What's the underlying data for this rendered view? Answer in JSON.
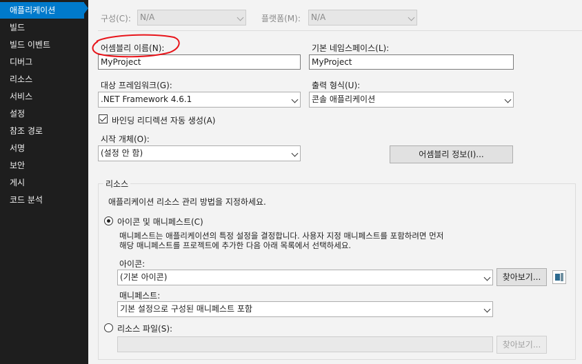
{
  "sidebar": {
    "items": [
      {
        "label": "애플리케이션",
        "selected": true
      },
      {
        "label": "빌드"
      },
      {
        "label": "빌드 이벤트"
      },
      {
        "label": "디버그"
      },
      {
        "label": "리소스"
      },
      {
        "label": "서비스"
      },
      {
        "label": "설정"
      },
      {
        "label": "참조 경로"
      },
      {
        "label": "서명"
      },
      {
        "label": "보안"
      },
      {
        "label": "게시"
      },
      {
        "label": "코드 분석"
      }
    ],
    "selected_color": "#007acc"
  },
  "top": {
    "config_label": "구성(C):",
    "config_value": "N/A",
    "platform_label": "플랫폼(M):",
    "platform_value": "N/A"
  },
  "assembly": {
    "label": "어셈블리 이름(N):",
    "value": "MyProject",
    "highlight_color": "#e8141a"
  },
  "namespace": {
    "label": "기본 네임스페이스(L):",
    "value": "MyProject"
  },
  "target_framework": {
    "label": "대상 프레임워크(G):",
    "value": ".NET Framework 4.6.1"
  },
  "output_type": {
    "label": "출력 형식(U):",
    "value": "콘솔 애플리케이션"
  },
  "binding_redirect": {
    "label": "바인딩 리디렉션 자동 생성(A)",
    "checked": true
  },
  "startup_object": {
    "label": "시작 개체(O):",
    "value": "(설정 안 함)"
  },
  "assembly_info_button": "어셈블리 정보(I)...",
  "resources": {
    "title": "리소스",
    "description": "애플리케이션 리소스 관리 방법을 지정하세요.",
    "icon_manifest_option": {
      "label": "아이콘 및 매니페스트(C)",
      "selected": true,
      "help_line1": "매니페스트는 애플리케이션의 특정 설정을 결정합니다. 사용자 지정 매니페스트를 포함하려면 먼저",
      "help_line2": "해당 매니페스트를 프로젝트에 추가한 다음 아래 목록에서 선택하세요."
    },
    "icon": {
      "label": "아이콘:",
      "value": "(기본 아이콘)",
      "browse_button": "찾아보기..."
    },
    "manifest": {
      "label": "매니페스트:",
      "value": "기본 설정으로 구성된 매니페스트 포함"
    },
    "resource_file_option": {
      "label": "리소스 파일(S):",
      "selected": false,
      "value": "",
      "browse_button": "찾아보기..."
    }
  }
}
